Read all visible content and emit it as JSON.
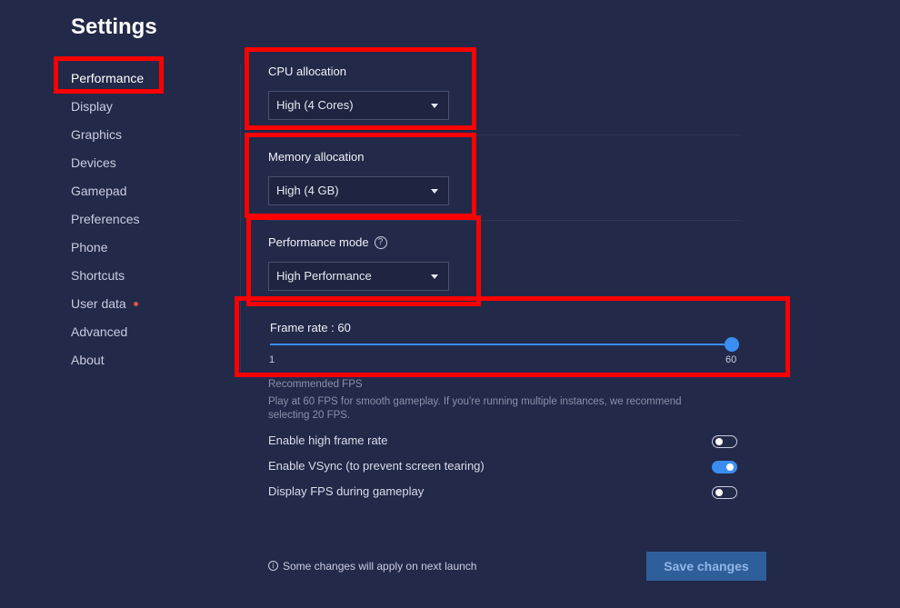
{
  "page": {
    "title": "Settings"
  },
  "sidebar": {
    "items": [
      {
        "label": "Performance"
      },
      {
        "label": "Display"
      },
      {
        "label": "Graphics"
      },
      {
        "label": "Devices"
      },
      {
        "label": "Gamepad"
      },
      {
        "label": "Preferences"
      },
      {
        "label": "Phone"
      },
      {
        "label": "Shortcuts"
      },
      {
        "label": "User data"
      },
      {
        "label": "Advanced"
      },
      {
        "label": "About"
      }
    ],
    "active_index": 0
  },
  "cpu": {
    "label": "CPU allocation",
    "value": "High (4 Cores)"
  },
  "memory": {
    "label": "Memory allocation",
    "value": "High (4 GB)"
  },
  "perf_mode": {
    "label": "Performance mode",
    "help_icon": "question-circle-icon",
    "value": "High Performance"
  },
  "frame_rate": {
    "label": "Frame rate : 60",
    "min_label": "1",
    "max_label": "60",
    "value": 60,
    "min": 1,
    "max": 60
  },
  "recommended": {
    "title": "Recommended FPS",
    "text_line1": "Play at 60 FPS for smooth gameplay. If you're running multiple instances, we recommend",
    "text_line2": "selecting 20 FPS."
  },
  "toggles": [
    {
      "label": "Enable high frame rate",
      "on": false
    },
    {
      "label": "Enable VSync (to prevent screen tearing)",
      "on": true
    },
    {
      "label": "Display FPS during gameplay",
      "on": false
    }
  ],
  "footer": {
    "note": "Some changes will apply on next launch",
    "info_icon": "info-circle-icon",
    "save_label": "Save changes"
  },
  "colors": {
    "background": "#232948",
    "accent": "#3a8ef2",
    "highlight": "#ff0000",
    "notification_dot": "#e0553f"
  }
}
